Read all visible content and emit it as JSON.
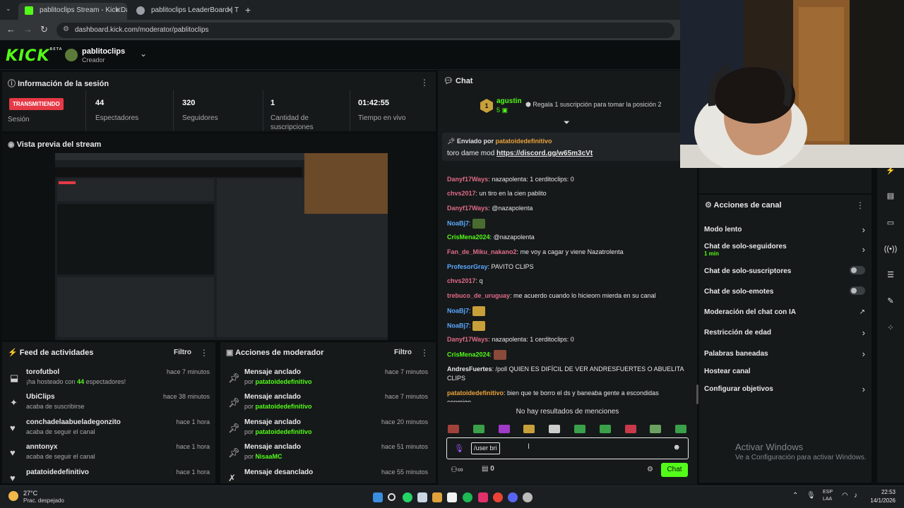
{
  "browser": {
    "tabs": [
      {
        "label": "pablitoclips Stream - Kick Dashb",
        "active": true
      },
      {
        "label": "pablitoclips LeaderBoard | The I",
        "active": false
      }
    ],
    "url": "dashboard.kick.com/moderator/pablitoclips"
  },
  "header": {
    "logo": "KICK",
    "logo_badge": "BETA",
    "channel_name": "pablitoclips",
    "channel_role": "Creador"
  },
  "session": {
    "title": "Información de la sesión",
    "status_badge": "TRANSMITIENDO",
    "status_label": "Sesión",
    "stats": [
      {
        "value": "44",
        "label": "Espectadores"
      },
      {
        "value": "320",
        "label": "Seguidores"
      },
      {
        "value": "1",
        "label": "Cantidad de suscripciones"
      },
      {
        "value": "01:42:55",
        "label": "Tiempo en vivo"
      }
    ]
  },
  "preview": {
    "title": "Vista previa del stream"
  },
  "activity_feed": {
    "title": "Feed de actividades",
    "filter": "Filtro",
    "items": [
      {
        "icon": "host-icon",
        "name": "torofutbol",
        "pre": "¡ha hosteado con ",
        "count": "44",
        "post": " espectadores!",
        "time": "hace 7 minutos"
      },
      {
        "icon": "star-icon",
        "name": "UbiClips",
        "pre": "acaba de suscribirse",
        "count": "",
        "post": "",
        "time": "hace 38 minutos"
      },
      {
        "icon": "heart-icon",
        "name": "conchadelaabueladegonzito",
        "pre": "acaba de seguir el canal",
        "count": "",
        "post": "",
        "time": "hace 1 hora"
      },
      {
        "icon": "heart-icon",
        "name": "anntonyx",
        "pre": "acaba de seguir el canal",
        "count": "",
        "post": "",
        "time": "hace 1 hora"
      },
      {
        "icon": "heart-icon",
        "name": "patatoidedefinitivo",
        "pre": "",
        "count": "",
        "post": "",
        "time": "hace 1 hora"
      }
    ]
  },
  "mod_actions": {
    "title": "Acciones de moderador",
    "filter": "Filtro",
    "items": [
      {
        "action": "Mensaje anclado",
        "by": "por",
        "user": "patatoidedefinitivo",
        "time": "hace 7 minutos"
      },
      {
        "action": "Mensaje anclado",
        "by": "por",
        "user": "patatoidedefinitivo",
        "time": "hace 7 minutos"
      },
      {
        "action": "Mensaje anclado",
        "by": "por",
        "user": "patatoidedefinitivo",
        "time": "hace 20 minutos"
      },
      {
        "action": "Mensaje anclado",
        "by": "por",
        "user": "NisaaMC",
        "time": "hace 51 minutos"
      },
      {
        "action": "Mensaje desanclado",
        "by": "",
        "user": "",
        "time": "hace 55 minutos"
      }
    ]
  },
  "chat": {
    "title": "Chat",
    "leader": {
      "rank": "1",
      "name": "agustin",
      "subs": "5",
      "prompt": "Regala 1 suscripción para tomar la posición 2"
    },
    "pinned": {
      "label": "Enviado por",
      "user": "patatoidedefinitivo",
      "text": "toro dame mod ",
      "link": "https://discord.gg/w65m3cVt"
    },
    "messages": [
      {
        "user": "Danyf17Ways",
        "color": "#e06b88",
        "text": "nazapolenta: 1 cerditoclips: 0",
        "emote": ""
      },
      {
        "user": "chvs2017",
        "color": "#e06b88",
        "text": "un tiro en la cien pablito",
        "emote": ""
      },
      {
        "user": "Danyf17Ways",
        "color": "#e06b88",
        "text": "@nazapolenta",
        "emote": ""
      },
      {
        "user": "NoaBj7",
        "color": "#5aa9ff",
        "text": "",
        "emote": "#4a6b2f"
      },
      {
        "user": "CrisMena2024",
        "color": "#53fc18",
        "text": "@nazapolenta",
        "emote": ""
      },
      {
        "user": "Fan_de_Miku_nakano2",
        "color": "#e06b88",
        "text": "me voy a cagar y viene Nazatrolenta",
        "emote": ""
      },
      {
        "user": "ProfesorGray",
        "color": "#5aa9ff",
        "text": "PAVITO CLIPS",
        "emote": ""
      },
      {
        "user": "chvs2017",
        "color": "#e06b88",
        "text": "q",
        "emote": ""
      },
      {
        "user": "trebuco_de_uruguay",
        "color": "#e06b88",
        "text": "me acuerdo cuando lo hicieorn mierda en su canal",
        "emote": ""
      },
      {
        "user": "NoaBj7",
        "color": "#5aa9ff",
        "text": "",
        "emote": "#c8a03a"
      },
      {
        "user": "NoaBj7",
        "color": "#5aa9ff",
        "text": "",
        "emote": "#c8a03a"
      },
      {
        "user": "Danyf17Ways",
        "color": "#e06b88",
        "text": "nazapolenta: 1 cerditoclips: 0",
        "emote": ""
      },
      {
        "user": "CrisMena2024",
        "color": "#53fc18",
        "text": "",
        "emote": "#8a4a3a"
      },
      {
        "user": "AndresFuertes",
        "color": "#e8e8e8",
        "text": "/poll QUIEN ES DIFÍCIL DE VER ANDRESFUERTES O ABUELITA",
        "emote": ""
      },
      {
        "user": "",
        "color": "#e8e8e8",
        "text": "CLIPS",
        "emote": ""
      },
      {
        "user": "patatoidedefinitivo",
        "color": "#e9a13b",
        "text": "bien que te borro el ds y baneaba gente a escondidas",
        "emote": ""
      },
      {
        "user": "",
        "color": "#e8e8e8",
        "text": "conmigo",
        "emote": ""
      }
    ],
    "no_results": "No hay resultados de menciones",
    "input_value": "/user bri",
    "footer_count": "0",
    "send_label": "Chat"
  },
  "channel_actions": {
    "title": "Acciones de canal",
    "items": [
      {
        "label": "Modo lento",
        "sub": "",
        "control": "chevron"
      },
      {
        "label": "Chat de solo-seguidores",
        "sub": "1 min",
        "control": "chevron"
      },
      {
        "label": "Chat de solo-suscriptores",
        "sub": "",
        "control": "toggle"
      },
      {
        "label": "Chat de solo-emotes",
        "sub": "",
        "control": "toggle"
      },
      {
        "label": "Moderación del chat con IA",
        "sub": "",
        "control": "external"
      },
      {
        "label": "Restricción de edad",
        "sub": "",
        "control": "chevron"
      },
      {
        "label": "Palabras baneadas",
        "sub": "",
        "control": "chevron"
      },
      {
        "label": "Hostear canal",
        "sub": "",
        "control": "none"
      },
      {
        "label": "Configurar objetivos",
        "sub": "",
        "control": "chevron"
      }
    ],
    "watermark_title": "Activar Windows",
    "watermark_sub": "Ve a Configuración para activar Windows."
  },
  "taskbar": {
    "weather_temp": "27°C",
    "weather_desc": "Prac. despejado",
    "lang_top": "ESP",
    "lang_bottom": "LAA",
    "time": "22:53",
    "date": "14/1/2026"
  },
  "colors": {
    "accent": "#53fc18",
    "live": "#e63946",
    "panel": "#16191a"
  }
}
